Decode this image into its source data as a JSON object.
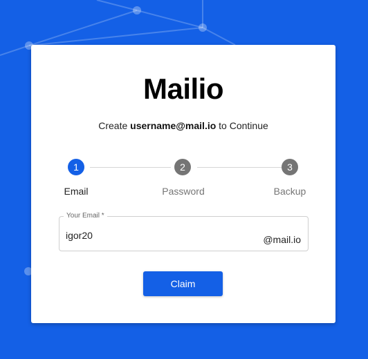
{
  "brand": {
    "title": "Mailio"
  },
  "subtitle": {
    "prefix": "Create ",
    "highlight": "username@mail.io",
    "suffix": " to Continue"
  },
  "stepper": {
    "active_color": "#1460e6",
    "inactive_color": "#757575",
    "steps": [
      {
        "number": "1",
        "label": "Email",
        "active": true
      },
      {
        "number": "2",
        "label": "Password",
        "active": false
      },
      {
        "number": "3",
        "label": "Backup",
        "active": false
      }
    ]
  },
  "email_field": {
    "label": "Your Email *",
    "value": "igor20",
    "suffix": "@mail.io"
  },
  "claim_button": {
    "label": "Claim"
  },
  "colors": {
    "background": "#1460e6",
    "card": "#ffffff"
  }
}
